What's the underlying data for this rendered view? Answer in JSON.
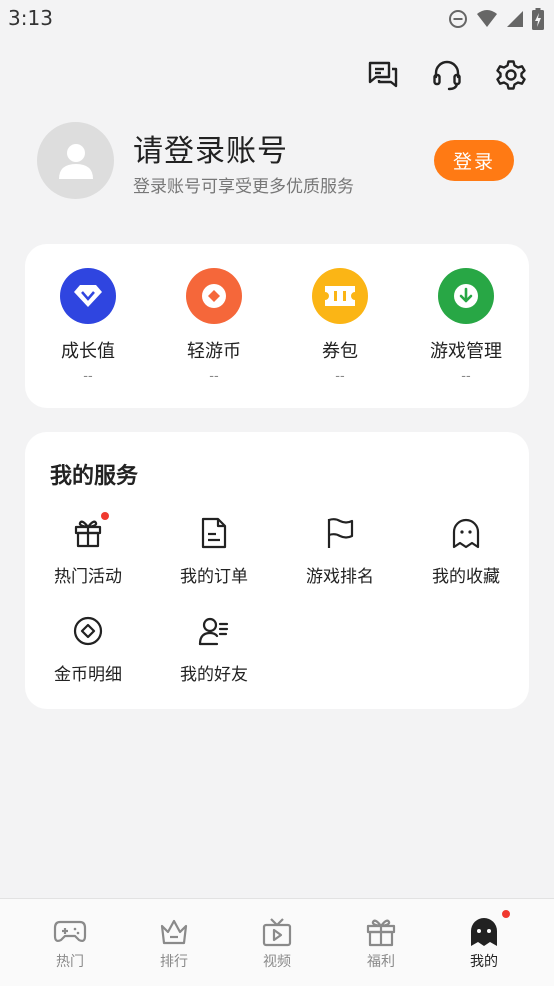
{
  "status_bar": {
    "time": "3:13"
  },
  "profile": {
    "title": "请登录账号",
    "subtitle": "登录账号可享受更多优质服务",
    "login_button": "登录"
  },
  "stats": [
    {
      "label": "成长值",
      "value": "--",
      "icon": "diamond-icon",
      "color": "#2f45e0"
    },
    {
      "label": "轻游币",
      "value": "--",
      "icon": "coin-icon",
      "color": "#f5673a"
    },
    {
      "label": "券包",
      "value": "--",
      "icon": "ticket-icon",
      "color": "#fbb515"
    },
    {
      "label": "游戏管理",
      "value": "--",
      "icon": "download-icon",
      "color": "#28a745"
    }
  ],
  "services": {
    "title": "我的服务",
    "items": [
      {
        "label": "热门活动",
        "icon": "gift-icon",
        "badge": true
      },
      {
        "label": "我的订单",
        "icon": "document-icon"
      },
      {
        "label": "游戏排名",
        "icon": "flag-icon"
      },
      {
        "label": "我的收藏",
        "icon": "ghost-icon"
      },
      {
        "label": "金币明细",
        "icon": "coin-outline-icon"
      },
      {
        "label": "我的好友",
        "icon": "friends-icon"
      }
    ]
  },
  "tabs": [
    {
      "label": "热门",
      "icon": "gamepad-icon"
    },
    {
      "label": "排行",
      "icon": "crown-icon"
    },
    {
      "label": "视频",
      "icon": "tv-icon"
    },
    {
      "label": "福利",
      "icon": "gift-icon"
    },
    {
      "label": "我的",
      "icon": "ghost-icon",
      "active": true,
      "badge": true
    }
  ],
  "colors": {
    "accent": "#ff7a14",
    "badge": "#f0392f"
  }
}
